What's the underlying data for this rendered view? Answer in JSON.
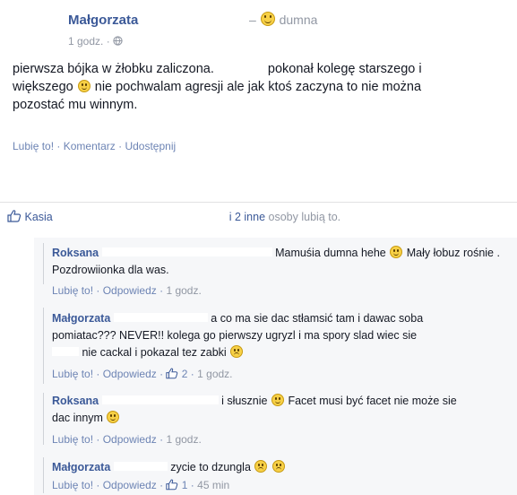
{
  "post": {
    "author": "Małgorzata",
    "feeling_prefix": "–",
    "feeling": "dumna",
    "time": "1 godz.",
    "globe_sep": "·",
    "text_line1_a": "pierwsza bójka w żłobku zaliczona.",
    "text_line1_b": "pokonał kolegę starszego i",
    "text_line2_a": "większego",
    "text_line2_b": "nie pochwalam agresji ale jak ktoś zaczyna to nie można",
    "text_line3": "pozostać mu winnym.",
    "actions": {
      "like": "Lubię to!",
      "sep1": "·",
      "comment": "Komentarz",
      "sep2": "·",
      "share": "Udostępnij"
    }
  },
  "likes_bar": {
    "first_name": "Kasia",
    "others": "i 2 inne",
    "suffix": "osoby lubią to."
  },
  "comments": [
    {
      "author": "Roksana",
      "line1_a": "Mamuśia dumna hehe",
      "line1_b": "Mały łobuz rośnie .",
      "line2": "Pozdrowiionka dla was.",
      "like": "Lubię to!",
      "reply": "Odpowiedz",
      "time": "1 godz."
    },
    {
      "author": "Małgorzata",
      "line1": "a co ma sie dac stłamsić tam i dawac soba",
      "line2": "pomiatac??? NEVER!! kolega go pierwszy ugryzl i ma spory slad wiec sie",
      "line3": "nie cackal i pokazal tez zabki",
      "like": "Lubię to!",
      "reply": "Odpowiedz",
      "likes": "2",
      "time": "1 godz."
    },
    {
      "author": "Roksana",
      "line1_a": "i słusznie",
      "line1_b": "Facet musi być facet nie może sie",
      "line2": "dac innym",
      "like": "Lubię to!",
      "reply": "Odpowiedz",
      "time": "1 godz."
    },
    {
      "author": "Małgorzata",
      "line1": "zycie to dzungla",
      "like": "Lubię to!",
      "reply": "Odpowiedz",
      "likes": "1",
      "time": "45 min"
    }
  ],
  "colors": {
    "link": "#3b5998",
    "muted": "#9197a3",
    "comment_bg": "#f6f7f9"
  },
  "icons": [
    "smile-icon",
    "sad-icon",
    "globe-icon",
    "thumbs-up-icon"
  ]
}
